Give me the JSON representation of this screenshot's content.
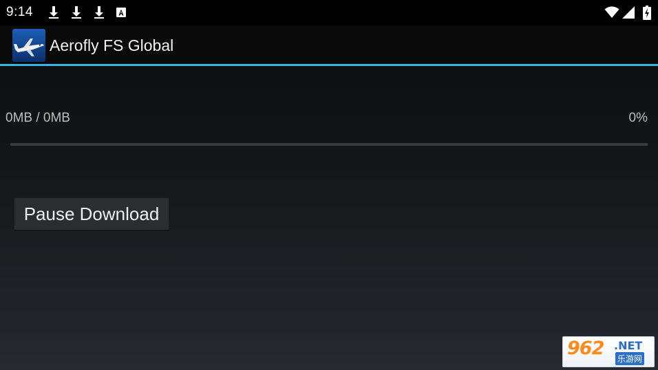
{
  "status_bar": {
    "time": "9:14",
    "notification_icons": [
      "download-icon",
      "download-icon",
      "download-icon",
      "font-a-icon"
    ],
    "system_icons": [
      "wifi-icon",
      "cell-signal-icon",
      "battery-charging-icon"
    ]
  },
  "action_bar": {
    "app_icon": "airplane-app-icon",
    "title": "Aerofly FS Global",
    "divider_color": "#33b5e5"
  },
  "download": {
    "size_text": "0MB / 0MB",
    "percent_text": "0%",
    "progress_fraction": 0,
    "pause_label": "Pause Download"
  },
  "watermark": {
    "number": "962",
    "domain": ".NET",
    "subtitle": "乐游网"
  },
  "colors": {
    "accent": "#33b5e5",
    "background_top": "#0e0f11",
    "background_bottom": "#262a30",
    "button": "#2b2d31"
  }
}
